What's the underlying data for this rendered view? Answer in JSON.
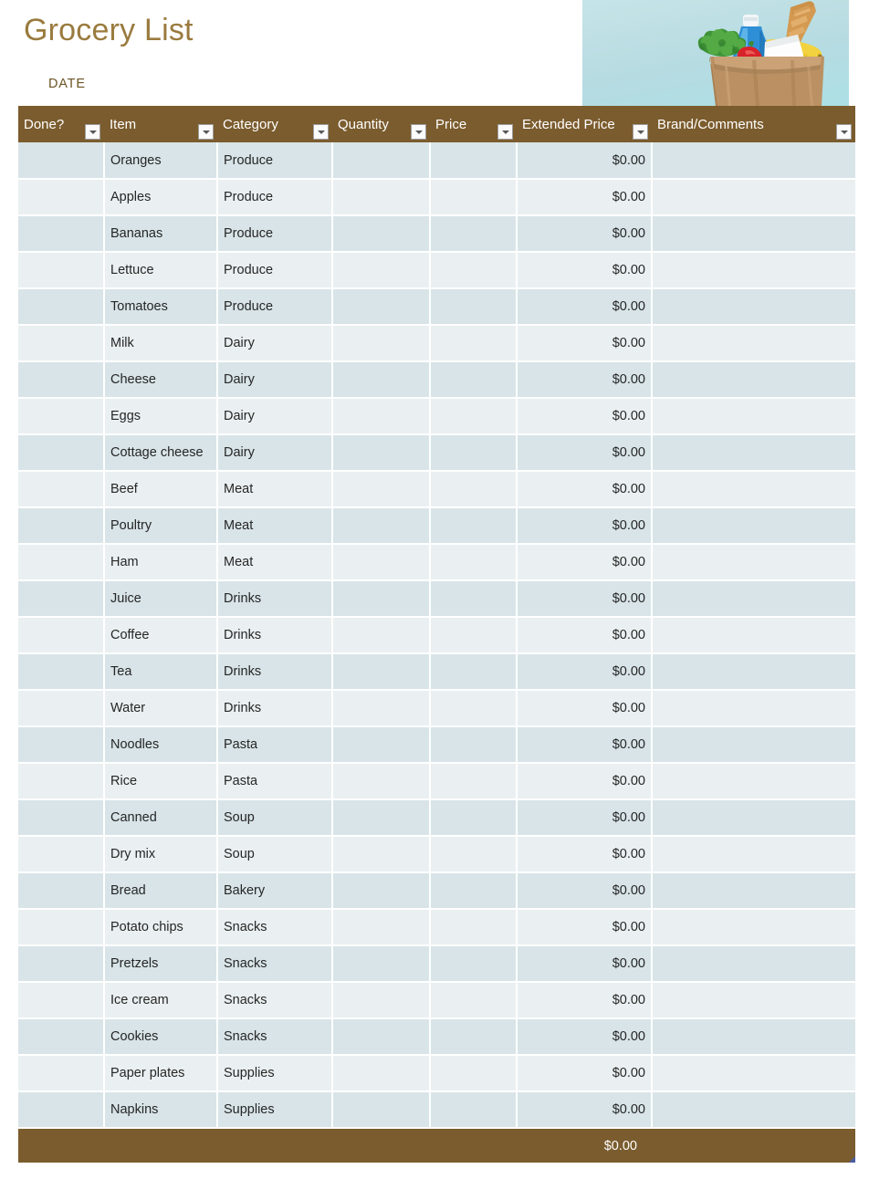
{
  "document": {
    "title": "Grocery List",
    "date_label": "DATE",
    "date_value": "",
    "title_color": "#9a7b3f",
    "header_bar_color": "#7b5c2e",
    "row_color_odd": "#d8e4e8",
    "row_color_even": "#eaf0f1"
  },
  "photo": {
    "alt": "paper grocery bag filled with groceries on a light blue background",
    "background_color": "#b9dee4"
  },
  "table": {
    "columns": [
      {
        "key": "done",
        "label": "Done?",
        "filter_icon": "chevron-down-icon",
        "align": "left"
      },
      {
        "key": "item",
        "label": "Item",
        "filter_icon": "chevron-down-icon",
        "align": "left"
      },
      {
        "key": "category",
        "label": "Category",
        "filter_icon": "chevron-down-icon",
        "align": "left"
      },
      {
        "key": "quantity",
        "label": "Quantity",
        "filter_icon": "chevron-down-icon",
        "align": "left"
      },
      {
        "key": "price",
        "label": "Price",
        "filter_icon": "chevron-down-icon",
        "align": "left"
      },
      {
        "key": "extended",
        "label": "Extended Price",
        "filter_icon": "chevron-down-icon",
        "align": "right"
      },
      {
        "key": "brand",
        "label": "Brand/Comments",
        "filter_icon": "chevron-down-icon",
        "align": "left"
      }
    ],
    "rows": [
      {
        "done": "",
        "item": "Oranges",
        "category": "Produce",
        "quantity": "",
        "price": "",
        "extended": "$0.00",
        "brand": ""
      },
      {
        "done": "",
        "item": "Apples",
        "category": "Produce",
        "quantity": "",
        "price": "",
        "extended": "$0.00",
        "brand": ""
      },
      {
        "done": "",
        "item": "Bananas",
        "category": "Produce",
        "quantity": "",
        "price": "",
        "extended": "$0.00",
        "brand": ""
      },
      {
        "done": "",
        "item": "Lettuce",
        "category": "Produce",
        "quantity": "",
        "price": "",
        "extended": "$0.00",
        "brand": ""
      },
      {
        "done": "",
        "item": "Tomatoes",
        "category": "Produce",
        "quantity": "",
        "price": "",
        "extended": "$0.00",
        "brand": ""
      },
      {
        "done": "",
        "item": "Milk",
        "category": "Dairy",
        "quantity": "",
        "price": "",
        "extended": "$0.00",
        "brand": ""
      },
      {
        "done": "",
        "item": "Cheese",
        "category": "Dairy",
        "quantity": "",
        "price": "",
        "extended": "$0.00",
        "brand": ""
      },
      {
        "done": "",
        "item": "Eggs",
        "category": "Dairy",
        "quantity": "",
        "price": "",
        "extended": "$0.00",
        "brand": ""
      },
      {
        "done": "",
        "item": "Cottage cheese",
        "category": "Dairy",
        "quantity": "",
        "price": "",
        "extended": "$0.00",
        "brand": ""
      },
      {
        "done": "",
        "item": "Beef",
        "category": "Meat",
        "quantity": "",
        "price": "",
        "extended": "$0.00",
        "brand": ""
      },
      {
        "done": "",
        "item": "Poultry",
        "category": "Meat",
        "quantity": "",
        "price": "",
        "extended": "$0.00",
        "brand": ""
      },
      {
        "done": "",
        "item": "Ham",
        "category": "Meat",
        "quantity": "",
        "price": "",
        "extended": "$0.00",
        "brand": ""
      },
      {
        "done": "",
        "item": "Juice",
        "category": "Drinks",
        "quantity": "",
        "price": "",
        "extended": "$0.00",
        "brand": ""
      },
      {
        "done": "",
        "item": "Coffee",
        "category": "Drinks",
        "quantity": "",
        "price": "",
        "extended": "$0.00",
        "brand": ""
      },
      {
        "done": "",
        "item": "Tea",
        "category": "Drinks",
        "quantity": "",
        "price": "",
        "extended": "$0.00",
        "brand": ""
      },
      {
        "done": "",
        "item": "Water",
        "category": "Drinks",
        "quantity": "",
        "price": "",
        "extended": "$0.00",
        "brand": ""
      },
      {
        "done": "",
        "item": "Noodles",
        "category": "Pasta",
        "quantity": "",
        "price": "",
        "extended": "$0.00",
        "brand": ""
      },
      {
        "done": "",
        "item": "Rice",
        "category": "Pasta",
        "quantity": "",
        "price": "",
        "extended": "$0.00",
        "brand": ""
      },
      {
        "done": "",
        "item": "Canned",
        "category": "Soup",
        "quantity": "",
        "price": "",
        "extended": "$0.00",
        "brand": ""
      },
      {
        "done": "",
        "item": "Dry mix",
        "category": "Soup",
        "quantity": "",
        "price": "",
        "extended": "$0.00",
        "brand": ""
      },
      {
        "done": "",
        "item": "Bread",
        "category": "Bakery",
        "quantity": "",
        "price": "",
        "extended": "$0.00",
        "brand": ""
      },
      {
        "done": "",
        "item": "Potato chips",
        "category": "Snacks",
        "quantity": "",
        "price": "",
        "extended": "$0.00",
        "brand": ""
      },
      {
        "done": "",
        "item": "Pretzels",
        "category": "Snacks",
        "quantity": "",
        "price": "",
        "extended": "$0.00",
        "brand": ""
      },
      {
        "done": "",
        "item": "Ice cream",
        "category": "Snacks",
        "quantity": "",
        "price": "",
        "extended": "$0.00",
        "brand": ""
      },
      {
        "done": "",
        "item": "Cookies",
        "category": "Snacks",
        "quantity": "",
        "price": "",
        "extended": "$0.00",
        "brand": ""
      },
      {
        "done": "",
        "item": "Paper plates",
        "category": "Supplies",
        "quantity": "",
        "price": "",
        "extended": "$0.00",
        "brand": ""
      },
      {
        "done": "",
        "item": "Napkins",
        "category": "Supplies",
        "quantity": "",
        "price": "",
        "extended": "$0.00",
        "brand": ""
      }
    ],
    "total_row": {
      "done": "",
      "item": "",
      "category": "",
      "quantity": "",
      "price": "",
      "extended": "$0.00",
      "brand": ""
    }
  }
}
